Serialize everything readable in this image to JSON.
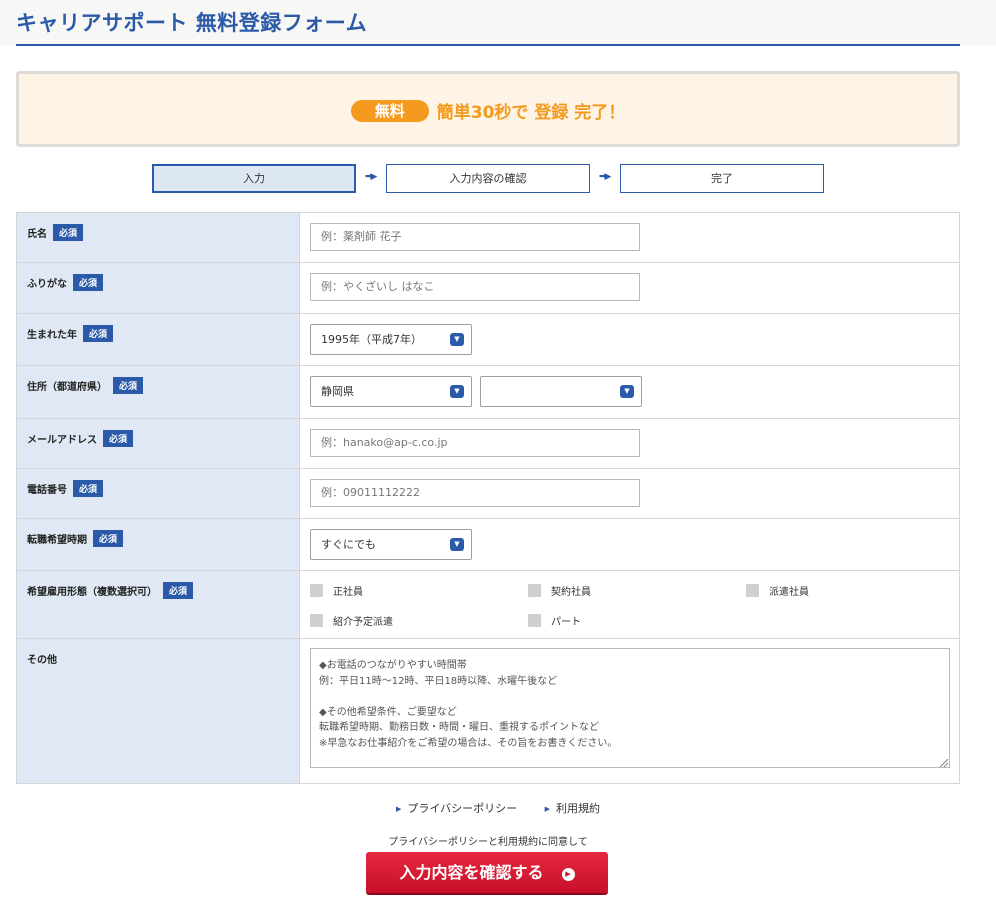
{
  "header": {
    "title": "キャリアサポート 無料登録フォーム"
  },
  "banner": {
    "badge": "無料",
    "text": "簡単30秒で 登録 完了！"
  },
  "steps": [
    {
      "label": "入力",
      "active": true
    },
    {
      "label": "入力内容の確認",
      "active": false
    },
    {
      "label": "完了",
      "active": false
    }
  ],
  "step_arrow": "➡▶",
  "required_label": "必須",
  "fields": {
    "name": {
      "label": "氏名",
      "placeholder": "例：薬剤師 花子"
    },
    "furigana": {
      "label": "ふりがな",
      "placeholder": "例：やくざいし はなこ"
    },
    "birth_year": {
      "label": "生まれた年",
      "value": "1995年（平成7年）"
    },
    "address": {
      "label": "住所（都道府県）",
      "prefecture": "静岡県",
      "city": ""
    },
    "email": {
      "label": "メールアドレス",
      "placeholder": "例：hanako@ap-c.co.jp"
    },
    "phone": {
      "label": "電話番号",
      "placeholder": "例：09011112222"
    },
    "timing": {
      "label": "転職希望時期",
      "value": "すぐにでも"
    },
    "employment": {
      "label": "希望雇用形態（複数選択可）",
      "options": [
        "正社員",
        "契約社員",
        "派遣社員",
        "紹介予定派遣",
        "パート"
      ]
    },
    "other": {
      "label": "その他",
      "placeholder": "◆お電話のつながりやすい時間帯\n例：平日11時〜12時、平日18時以降、水曜午後など\n\n◆その他希望条件、ご要望など\n転職希望時期、勤務日数・時間・曜日、重視するポイントなど\n※早急なお仕事紹介をご希望の場合は、その旨をお書きください。"
    }
  },
  "links": {
    "privacy": "プライバシーポリシー",
    "terms": "利用規約"
  },
  "agree_text": "プライバシーポリシーと利用規約に同意して",
  "submit_label": "入力内容を確認する",
  "colors": {
    "accent": "#2a5aa8",
    "orange": "#f39a1f",
    "submit": "#d6182f",
    "label_bg": "#dfe8f4"
  }
}
